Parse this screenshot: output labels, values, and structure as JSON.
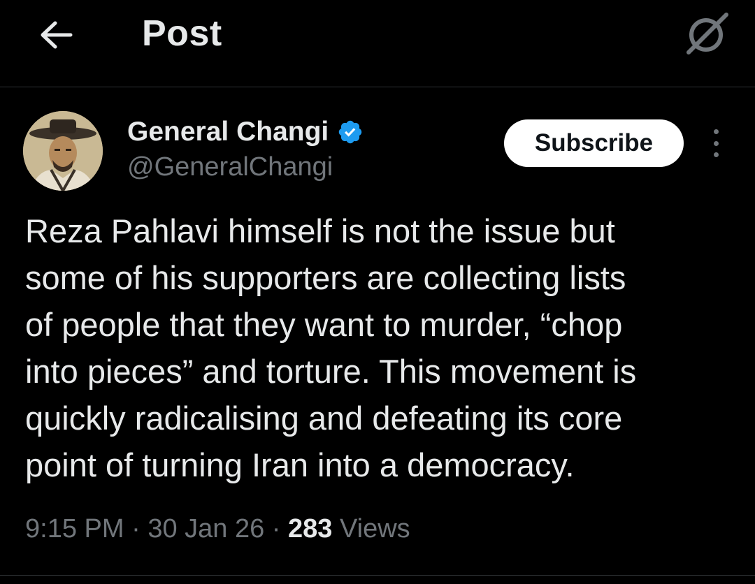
{
  "header": {
    "title": "Post",
    "back_icon": "arrow-left-icon",
    "grok_icon": "grok-icon"
  },
  "author": {
    "name": "General Changi",
    "handle": "@GeneralChangi",
    "verified": true,
    "verified_color": "#1d9bf0",
    "subscribe_label": "Subscribe",
    "more_icon": "more-vertical-icon"
  },
  "tweet": {
    "lines": [
      "Reza Pahlavi himself is not the issue but",
      "some of his supporters are collecting lists",
      "of people that they want to murder, “chop",
      "into pieces” and torture. This movement is",
      "quickly radicalising and defeating its core",
      "point of turning Iran into a democracy."
    ]
  },
  "meta": {
    "time": "9:15 PM",
    "separator": " · ",
    "date": "30 Jan 26",
    "views_count": "283",
    "views_label": " Views"
  },
  "colors": {
    "background": "#000000",
    "text_primary": "#e7e9ea",
    "text_secondary": "#71767b",
    "divider": "#2f3336",
    "accent": "#1d9bf0"
  }
}
